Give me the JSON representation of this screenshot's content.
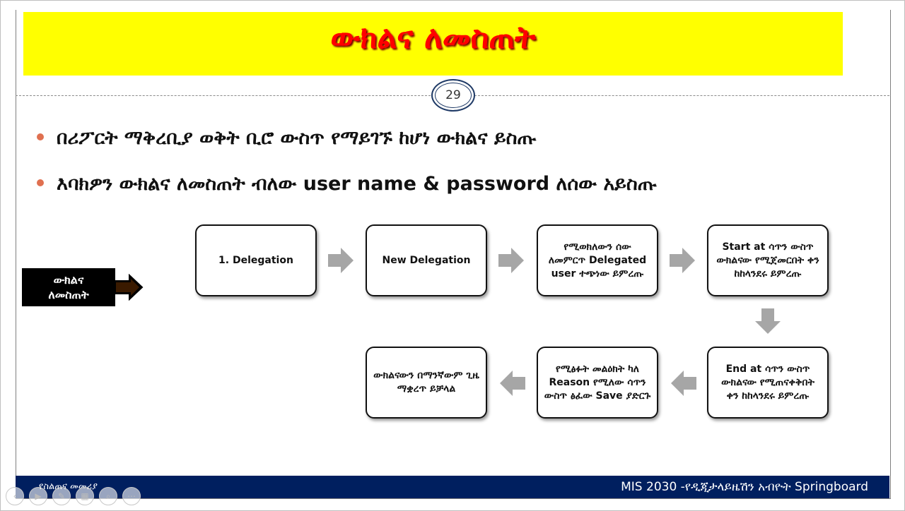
{
  "slide": {
    "title": "ውክልና ለመስጠት",
    "page_number": "29",
    "bullets": [
      "በሪፖርት ማቅረቢያ ወቅት ቢሮ ውስጥ የማይገኙ ከሆነ ውክልና ይስጡ",
      "እባክዎን ውክልና ለመስጠት ብለው user name & password ለሰው አይስጡ"
    ]
  },
  "flow": {
    "start_label_line1": "ውክልና",
    "start_label_line2": "ለመስጠት",
    "steps": [
      "1. Delegation",
      "New Delegation",
      "የሚወክለውን ሰው ለመምርጥ Delegated user ተጭነው ይምረጡ",
      "Start at ሳጥን ውስጥ ውክልናው የሚጀመርበት ቀን ከከላንደሩ ይምረጡ",
      "End at ሳጥን ውስጥ ውክልናው የሚጠናቀቅበት ቀን ከከላንደሩ ይምረጡ",
      "የሚፅፉት መልዕክት ካለ Reason የሚለው ሳጥን ውስጥ ፅፈው Save ያድርጉ",
      "ውክልናውን በማንኛውም ጊዜ ማቋረጥ ይቻላል"
    ]
  },
  "footer": {
    "left": "የስልጠና መመሪያ",
    "right": "MIS 2030 -የዲጂታላይዜሽን አብዮት Springboard"
  },
  "controls": {
    "icons": [
      "prev-icon",
      "play-icon",
      "pen-icon",
      "slides-icon",
      "zoom-icon",
      "more-icon"
    ],
    "glyphs": [
      "‹",
      "▶",
      "✎",
      "▦",
      "⌕",
      "⋯"
    ]
  },
  "colors": {
    "title_band": "#ffff00",
    "title_text": "#ff0000",
    "footer_bg": "#001f5f",
    "bullet_dot": "#e07050",
    "arrow_gray": "#a6a6a6"
  }
}
